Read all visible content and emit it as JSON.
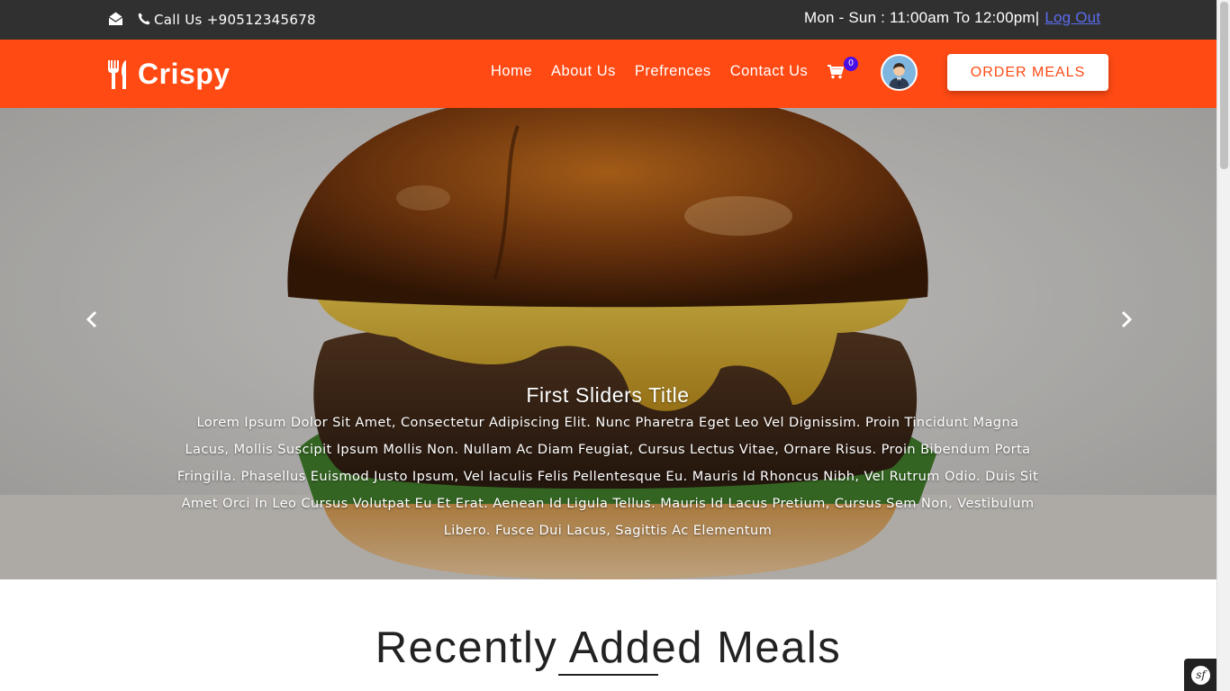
{
  "topbar": {
    "call_text": "Call Us +90512345678",
    "hours_text": "Mon - Sun : 11:00am To 12:00pm|",
    "logout_label": "Log Out"
  },
  "navbar": {
    "brand": "Crispy",
    "links": [
      "Home",
      "About Us",
      "Prefrences",
      "Contact Us"
    ],
    "cart_count": "0",
    "order_label": "ORDER MEALS"
  },
  "slider": {
    "title": "First Sliders Title",
    "body": "Lorem Ipsum Dolor Sit Amet, Consectetur Adipiscing Elit. Nunc Pharetra Eget Leo Vel Dignissim. Proin Tincidunt Magna Lacus, Mollis Suscipit Ipsum Mollis Non. Nullam Ac Diam Feugiat, Cursus Lectus Vitae, Ornare Risus. Proin Bibendum Porta Fringilla. Phasellus Euismod Justo Ipsum, Vel Iaculis Felis Pellentesque Eu. Mauris Id Rhoncus Nibh, Vel Rutrum Odio. Duis Sit Amet Orci In Leo Cursus Volutpat Eu Et Erat. Aenean Id Ligula Tellus. Mauris Id Lacus Pretium, Cursus Sem Non, Vestibulum Libero. Fusce Dui Lacus, Sagittis Ac Elementum"
  },
  "section": {
    "title": "Recently Added Meals"
  },
  "icons": {
    "envelope": "envelope-open-icon",
    "phone": "phone-icon",
    "cart": "shopping-cart-icon",
    "prev": "chevron-left-icon",
    "next": "chevron-right-icon",
    "debug": "symfony-icon"
  },
  "colors": {
    "topbar": "#303030",
    "brand_orange": "#ff4a14",
    "badge": "#4a0ee6",
    "logout_link": "#5b6cf0"
  }
}
